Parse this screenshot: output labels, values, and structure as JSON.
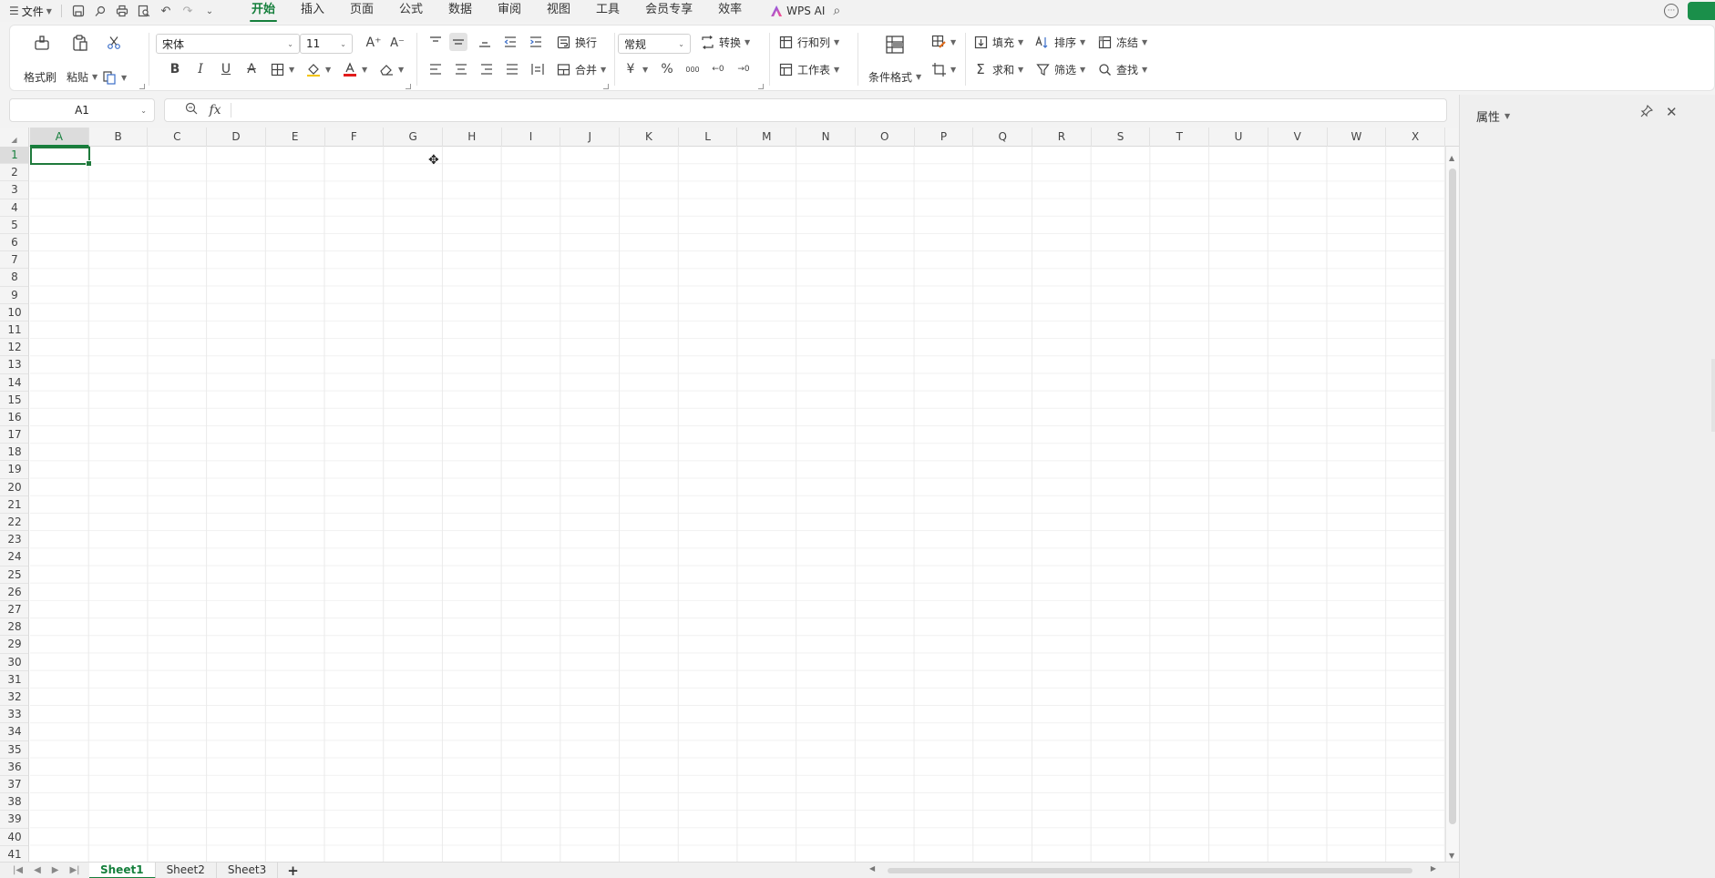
{
  "menubar": {
    "file_label": "文件",
    "tabs": [
      "开始",
      "插入",
      "页面",
      "公式",
      "数据",
      "审阅",
      "视图",
      "工具",
      "会员专享",
      "效率"
    ],
    "active_tab": "开始",
    "wps_ai_label": "WPS AI"
  },
  "ribbon": {
    "format_painter": "格式刷",
    "paste": "粘贴",
    "font_name": "宋体",
    "font_size": "11",
    "bold": "B",
    "italic": "I",
    "underline": "U",
    "strikethrough": "A",
    "wrap_text": "换行",
    "merge": "合并",
    "number_format": "常规",
    "convert": "转换",
    "currency": "¥",
    "percent": "%",
    "thousands": "000",
    "rows_cols": "行和列",
    "worksheet": "工作表",
    "conditional_format": "条件格式",
    "fill": "填充",
    "sort": "排序",
    "freeze": "冻结",
    "sum": "求和",
    "filter": "筛选",
    "find": "查找"
  },
  "formula_bar": {
    "name_box": "A1",
    "fx_label": "fx",
    "content": ""
  },
  "panel": {
    "title": "属性"
  },
  "grid": {
    "columns": [
      "A",
      "B",
      "C",
      "D",
      "E",
      "F",
      "G",
      "H",
      "I",
      "J",
      "K",
      "L",
      "M",
      "N",
      "O",
      "P",
      "Q",
      "R",
      "S",
      "T",
      "U",
      "V",
      "W",
      "X"
    ],
    "rows": [
      "1",
      "2",
      "3",
      "4",
      "5",
      "6",
      "7",
      "8",
      "9",
      "10",
      "11",
      "12",
      "13",
      "14",
      "15",
      "16",
      "17",
      "18",
      "19",
      "20",
      "21",
      "22",
      "23",
      "24",
      "25",
      "26",
      "27",
      "28",
      "29",
      "30",
      "31",
      "32",
      "33",
      "34",
      "35",
      "36",
      "37",
      "38",
      "39",
      "40",
      "41"
    ],
    "selected_column": "A",
    "selected_row": "1"
  },
  "sheets": {
    "tabs": [
      "Sheet1",
      "Sheet2",
      "Sheet3"
    ],
    "active": "Sheet1",
    "add_label": "+"
  }
}
